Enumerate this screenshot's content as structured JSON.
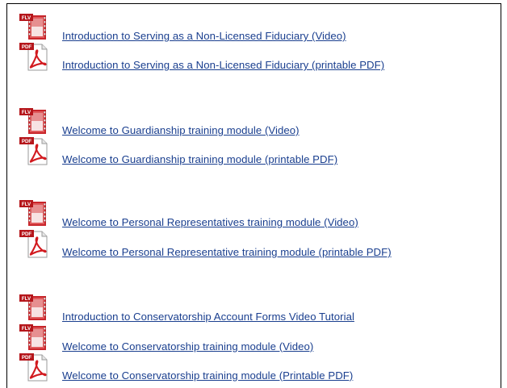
{
  "groups": [
    {
      "items": [
        {
          "icon": "flv-video-icon",
          "badge": "FLV",
          "label": "Introduction to Serving as a Non-Licensed Fiduciary (Video)"
        },
        {
          "icon": "pdf-document-icon",
          "badge": "PDF",
          "label": "Introduction to Serving as a Non-Licensed Fiduciary (printable PDF)"
        }
      ]
    },
    {
      "items": [
        {
          "icon": "flv-video-icon",
          "badge": "FLV",
          "label": "Welcome to Guardianship training module (Video)"
        },
        {
          "icon": "pdf-document-icon",
          "badge": "PDF",
          "label": "Welcome to Guardianship training module (printable PDF)"
        }
      ]
    },
    {
      "items": [
        {
          "icon": "flv-video-icon",
          "badge": "FLV",
          "label": "Welcome to Personal Representatives training module (Video)"
        },
        {
          "icon": "pdf-document-icon",
          "badge": "PDF",
          "label": "Welcome to Personal Representative training module (printable PDF)"
        }
      ]
    },
    {
      "items": [
        {
          "icon": "flv-video-icon",
          "badge": "FLV",
          "label": "Introduction to Conservatorship Account Forms Video Tutorial"
        },
        {
          "icon": "flv-video-icon",
          "badge": "FLV",
          "label": "Welcome to Conservatorship training module  (Video)"
        },
        {
          "icon": "pdf-document-icon",
          "badge": "PDF",
          "label": "Welcome to Conservatorship training module (Printable PDF)"
        }
      ]
    }
  ],
  "colors": {
    "link": "#1a3f8f",
    "badge": "#b5161b",
    "flv_frame": "#c9262b",
    "pdf_swoosh": "#d21a1f"
  }
}
